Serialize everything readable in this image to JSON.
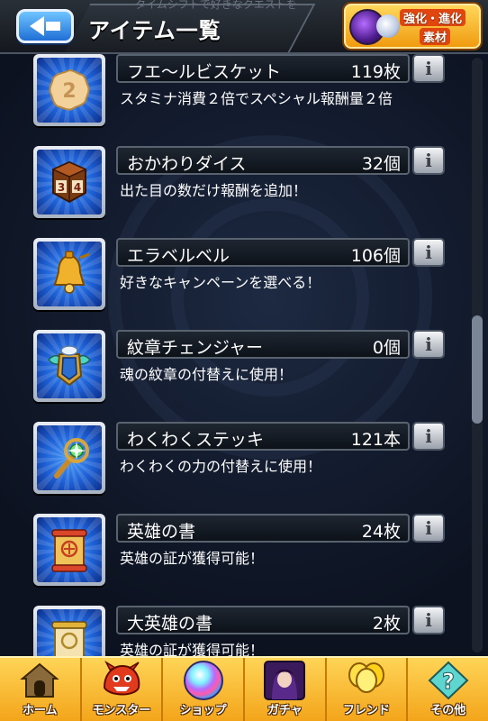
{
  "header": {
    "subtitle_fragment": "タイムシフトで好きなクエストを",
    "title": "アイテム一覧",
    "back_icon": "back-arrow-icon",
    "badge": {
      "line1": "強化・進化",
      "line2": "素材"
    }
  },
  "items": [
    {
      "name": "フエ〜ルビスケット",
      "count": "119枚",
      "description": "スタミナ消費２倍でスペシャル報酬量２倍",
      "icon": "biscuit-icon"
    },
    {
      "name": "おかわりダイス",
      "count": "32個",
      "description": "出た目の数だけ報酬を追加！",
      "icon": "dice-icon"
    },
    {
      "name": "エラベルベル",
      "count": "106個",
      "description": "好きなキャンペーンを選べる！",
      "icon": "bell-icon"
    },
    {
      "name": "紋章チェンジャー",
      "count": "0個",
      "description": "魂の紋章の付替えに使用！",
      "icon": "emblem-changer-icon"
    },
    {
      "name": "わくわくステッキ",
      "count": "121本",
      "description": "わくわくの力の付替えに使用！",
      "icon": "wand-icon"
    },
    {
      "name": "英雄の書",
      "count": "24枚",
      "description": "英雄の証が獲得可能！",
      "icon": "scroll-icon"
    },
    {
      "name": "大英雄の書",
      "count": "2枚",
      "description": "英雄の証が獲得可能！",
      "icon": "grand-scroll-icon"
    }
  ],
  "info_label": "i",
  "nav": [
    {
      "label": "ホーム",
      "icon": "home-icon"
    },
    {
      "label": "モンスター",
      "icon": "monster-icon"
    },
    {
      "label": "ショップ",
      "icon": "orb-icon"
    },
    {
      "label": "ガチャ",
      "icon": "gacha-icon"
    },
    {
      "label": "フレンド",
      "icon": "friend-balloon-icon"
    },
    {
      "label": "その他",
      "icon": "question-icon"
    }
  ]
}
